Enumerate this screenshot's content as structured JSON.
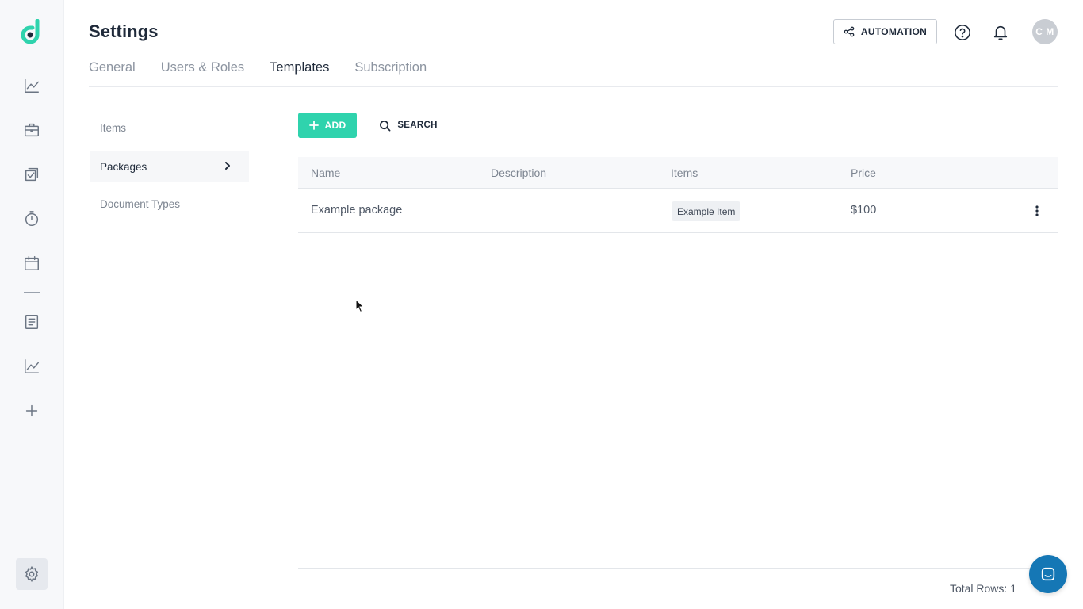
{
  "header": {
    "title": "Settings",
    "automation_label": "AUTOMATION",
    "avatar_initials": "C M"
  },
  "tabs": [
    {
      "label": "General",
      "active": false
    },
    {
      "label": "Users & Roles",
      "active": false
    },
    {
      "label": "Templates",
      "active": true
    },
    {
      "label": "Subscription",
      "active": false
    }
  ],
  "submenu": [
    {
      "label": "Items",
      "active": false
    },
    {
      "label": "Packages",
      "active": true
    },
    {
      "label": "Document Types",
      "active": false
    }
  ],
  "toolbar": {
    "add_label": "ADD",
    "search_label": "SEARCH"
  },
  "table": {
    "columns": [
      "Name",
      "Description",
      "Items",
      "Price"
    ],
    "rows": [
      {
        "name": "Example package",
        "description": "",
        "items": [
          "Example Item"
        ],
        "price": "$100"
      }
    ]
  },
  "footer": {
    "total_rows": "Total Rows: 1"
  },
  "sidebar_icons": [
    "logo-icon",
    "analytics-icon",
    "briefcase-icon",
    "tasks-icon",
    "timer-icon",
    "calendar-icon",
    "document-icon",
    "reports-icon",
    "add-icon",
    "settings-icon"
  ],
  "colors": {
    "accent": "#2fd3ad",
    "chat": "#1577b5",
    "text_dark": "#1f2a3a",
    "text_muted": "#7d8591"
  }
}
